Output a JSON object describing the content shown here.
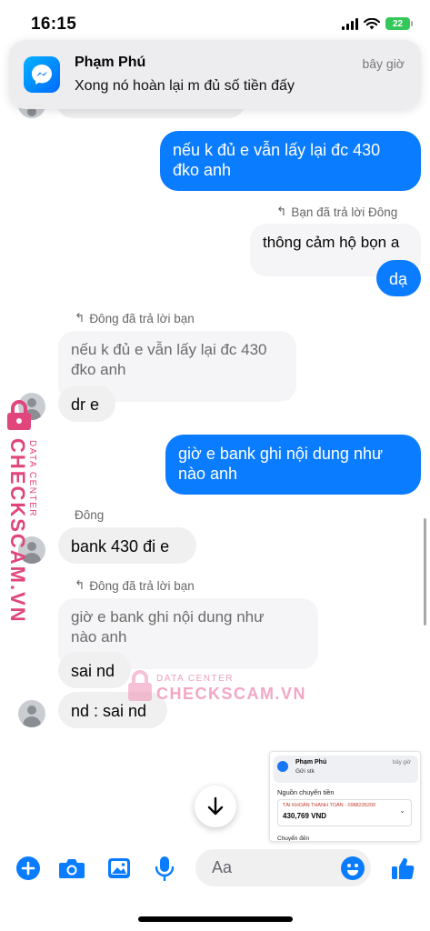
{
  "status_bar": {
    "time": "16:15",
    "battery": "22"
  },
  "notification": {
    "app_name": "Phạm Phú",
    "time": "bây giờ",
    "message": "Xong nó hoàn lại m đủ số tiền đấy"
  },
  "messages": {
    "m1": "nếu k đủ e vẫn lấy lại đc 430",
    "m1b": "đko anh",
    "reply_label_1": "Bạn đã trả lời Đông",
    "m2": "thông cảm hộ bọn a",
    "m3": "dạ",
    "reply_label_2": "Đông đã trả lời bạn",
    "q1": "nếu k đủ e vẫn lấy lại đc 430",
    "q1b": "đko anh",
    "m4": "dr e",
    "m5": "giờ e bank ghi nội dung như",
    "m5b": "nào anh",
    "sender": "Đông",
    "m6": "bank 430 đi e",
    "reply_label_3": "Đông đã trả lời bạn",
    "q2": "giờ e bank ghi nội dung như",
    "q2b": "nào anh",
    "m7": "sai nd",
    "m8": "nd : sai nd"
  },
  "watermark": {
    "brand": "CHECKSCAM.VN",
    "sub": "DATA CENTER"
  },
  "thumbnail": {
    "name": "Phạm Phú",
    "msg": "Gửi stk",
    "time": "bây giờ",
    "heading": "Nguồn chuyển tiền",
    "account": "TÀI KHOẢN THANH TOÁN - 0988235200",
    "amount": "430,769 VND",
    "heading2": "Chuyển đến"
  },
  "composer": {
    "placeholder": "Aa"
  },
  "colors": {
    "outgoing": "#0a7cff",
    "incoming": "#f0f0f0",
    "watermark": "#e0457b"
  },
  "icons": [
    "plus-icon",
    "camera-icon",
    "image-icon",
    "microphone-icon",
    "emoji-icon",
    "like-icon",
    "arrow-down-icon"
  ]
}
